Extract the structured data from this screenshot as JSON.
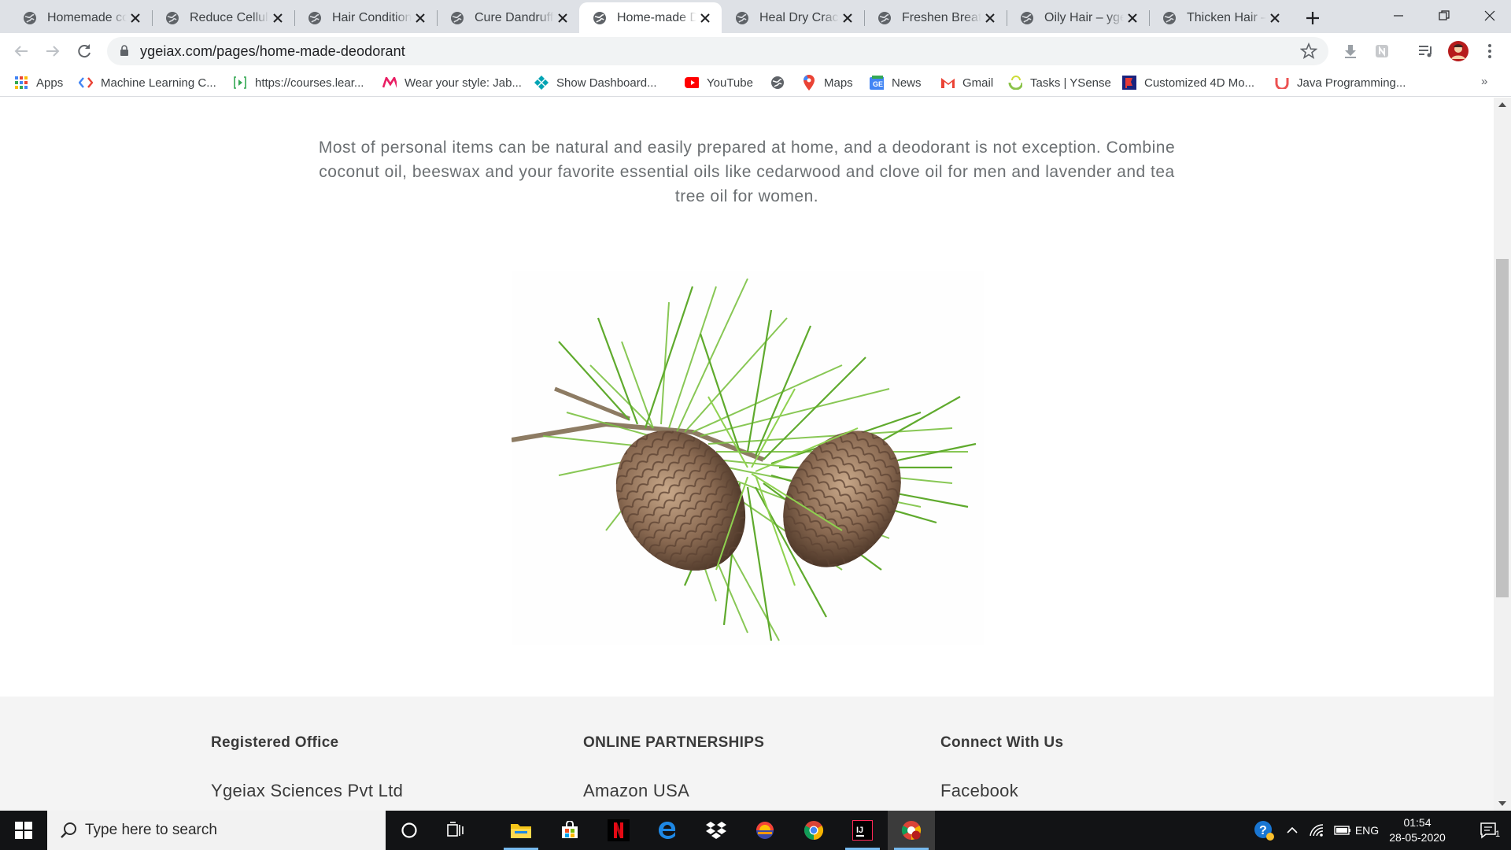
{
  "tabs": [
    {
      "title": "Homemade conditioner",
      "active": false
    },
    {
      "title": "Reduce Cellulite",
      "active": false
    },
    {
      "title": "Hair Conditioner",
      "active": false
    },
    {
      "title": "Cure Dandruff",
      "active": false
    },
    {
      "title": "Home-made Deodorant",
      "active": true
    },
    {
      "title": "Heal Dry Cracked",
      "active": false
    },
    {
      "title": "Freshen Breath",
      "active": false
    },
    {
      "title": "Oily Hair – ygeiax",
      "active": false
    },
    {
      "title": "Thicken Hair – ygeiax",
      "active": false
    }
  ],
  "toolbar": {
    "url": "ygeiax.com/pages/home-made-deodorant"
  },
  "bookmarks": [
    {
      "label": "Apps",
      "icon": "apps-grid-icon"
    },
    {
      "label": "Machine Learning C...",
      "icon": "code-icon"
    },
    {
      "label": "https://courses.lear...",
      "icon": "video-icon"
    },
    {
      "label": "Wear your style: Jab...",
      "icon": "myntra-icon"
    },
    {
      "label": "Show Dashboard...",
      "icon": "dashboard-icon"
    },
    {
      "label": "YouTube",
      "icon": "youtube-icon"
    },
    {
      "label": "",
      "icon": "globe-icon"
    },
    {
      "label": "Maps",
      "icon": "maps-pin-icon"
    },
    {
      "label": "News",
      "icon": "news-icon"
    },
    {
      "label": "Gmail",
      "icon": "gmail-icon"
    },
    {
      "label": "Tasks | YSense",
      "icon": "ysense-icon"
    },
    {
      "label": "Customized 4D Mo...",
      "icon": "flag-icon"
    },
    {
      "label": "Java Programming...",
      "icon": "udemy-icon"
    }
  ],
  "bookmarks_more": "»",
  "page": {
    "intro": "Most of personal items can be natural and easily prepared at home, and a deodorant is not exception. Combine coconut oil, beeswax and your favorite essential oils like cedarwood and clove oil for men and lavender and tea tree oil for women.",
    "image_subject": "pine-cones-with-needles"
  },
  "footer": {
    "col1": {
      "heading": "Registered Office",
      "item": "Ygeiax Sciences Pvt Ltd"
    },
    "col2": {
      "heading": "ONLINE PARTNERSHIPS",
      "item": "Amazon USA"
    },
    "col3": {
      "heading": "Connect With Us",
      "item": "Facebook"
    }
  },
  "taskbar": {
    "search_placeholder": "Type here to search",
    "language": "ENG",
    "time": "01:54",
    "date": "28-05-2020",
    "notification_count": "1"
  },
  "colors": {
    "tabstrip": "#dee1e6",
    "taskbar": "#121315",
    "footer_bg": "#f4f4f4",
    "intro_text": "#6b6f72"
  }
}
